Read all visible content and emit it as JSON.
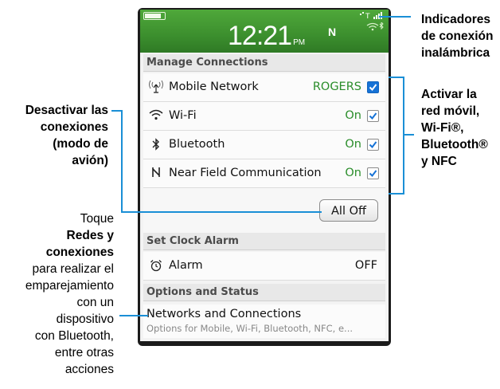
{
  "status": {
    "time": "12:21",
    "ampm": "PM",
    "nfc_glyph": "N"
  },
  "sections": {
    "manage": "Manage Connections",
    "alarm": "Set Clock Alarm",
    "options": "Options and Status"
  },
  "rows": [
    {
      "label": "Mobile Network",
      "value": "ROGERS",
      "icon": "antenna-icon",
      "checked": true
    },
    {
      "label": "Wi-Fi",
      "value": "On",
      "icon": "wifi-icon",
      "checked": true
    },
    {
      "label": "Bluetooth",
      "value": "On",
      "icon": "bluetooth-icon",
      "checked": true
    },
    {
      "label": "Near Field Communication",
      "value": "On",
      "icon": "nfc-icon",
      "checked": true
    }
  ],
  "all_off": "All Off",
  "alarm": {
    "label": "Alarm",
    "value": "OFF"
  },
  "networks": {
    "title": "Networks and Connections",
    "subtitle": "Options for Mobile, Wi-Fi, Bluetooth, NFC, e..."
  },
  "annotations": {
    "wireless_1": "Indicadores",
    "wireless_2": "de conexión",
    "wireless_3": "inalámbrica",
    "activate_1": "Activar la",
    "activate_2": "red móvil,",
    "activate_3": "Wi-Fi®,",
    "activate_4": "Bluetooth®",
    "activate_5": "y NFC",
    "disable_1": "Desactivar las",
    "disable_2": "conexiones",
    "disable_3": "(modo de",
    "disable_4": "avión)",
    "tap_1": "Toque",
    "tap_2": "Redes y",
    "tap_3": "conexiones",
    "tap_4": "para realizar el",
    "tap_5": "emparejamiento",
    "tap_6": "con un",
    "tap_7": "dispositivo",
    "tap_8": "con Bluetooth,",
    "tap_9": "entre otras",
    "tap_10": "acciones"
  },
  "colors": {
    "accent": "#1a8fd6",
    "on_green": "#2a8d2a",
    "status_green": "#3c8f2e"
  }
}
